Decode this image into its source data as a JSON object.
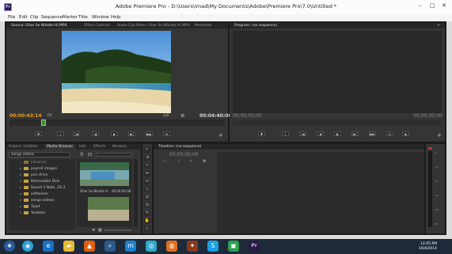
{
  "window": {
    "title": "Adobe Premiere Pro - D:\\Users\\imad\\My Documents\\Adobe\\Premiere Pro\\7.0\\Untitled *",
    "app_icon_text": "Pr",
    "controls": [
      "–",
      "□",
      "✕"
    ]
  },
  "menu": [
    "File",
    "Edit",
    "Clip",
    "Sequence",
    "Marker",
    "Title",
    "Window",
    "Help"
  ],
  "source_panel": {
    "tabs": [
      "Source: Ghar Se Nikalte Hi.MP4",
      "Effect Controls",
      "Audio Clip Mixer: Ghar Se Nikalte Hi.MP4",
      "Metadata"
    ],
    "timecode_in": "00:00:43:14",
    "fit_label": "Fit",
    "fraction_label": "1/2",
    "duration": "00:04:40:06"
  },
  "program_panel": {
    "tab": "Program: (no sequence)",
    "timecode_left": "00;00;00;00",
    "timecode_right": "00;00;00;00"
  },
  "project_panel": {
    "tabs": [
      "Project: Untitled",
      "Media Browser",
      "Info",
      "Effects",
      "Markers"
    ],
    "location": "songs videos",
    "tree_items": [
      "Libraries",
      "payroll images",
      "pen drive",
      "Removable Disk",
      "Sound 2 Nabi. ZA.3",
      "softwares",
      "songs videos",
      "Tpad",
      "Youtube"
    ],
    "clip_name": "Ghar Se Nikalte H",
    "clip_duration": "00:04:40:06"
  },
  "timeline_panel": {
    "tab": "Timeline: (no sequence)",
    "timecode": "00;00;00;00"
  },
  "audio_meter": {
    "labels": [
      "0",
      "-12",
      "-24",
      "-36",
      "-48",
      "dB"
    ]
  },
  "taskbar": {
    "clock_time": "12:05 PM",
    "clock_date": "10/4/2014"
  },
  "colors": {
    "timecode_active": "#e8a020",
    "panel_bg": "#353535",
    "taskbar_bg": "#1e2a3a"
  }
}
